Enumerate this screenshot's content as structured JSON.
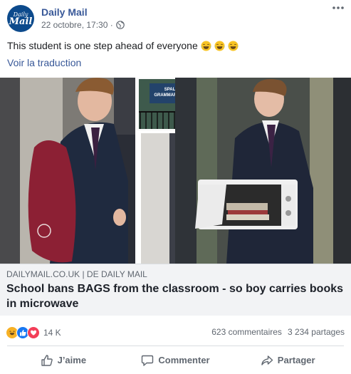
{
  "post": {
    "page_name": "Daily Mail",
    "avatar": {
      "line1": "Daily",
      "line2": "Mail"
    },
    "timestamp": "22 octobre, 17:30 ·",
    "text": "This student is one step ahead of everyone",
    "emojis": [
      "laughing-tears-emoji",
      "laughing-tears-emoji",
      "laughing-tears-emoji"
    ],
    "translate_link": "Voir la traduction"
  },
  "photo": {
    "sign_line1": "SPALDING",
    "sign_line2": "GRAMMAR SCHOOL"
  },
  "link_preview": {
    "domain": "DAILYMAIL.CO.UK",
    "separator": " | DE ",
    "source": "DAILY MAIL",
    "title": "School bans BAGS from the classroom - so boy carries books in microwave"
  },
  "stats": {
    "reaction_count": "14 K",
    "comments": "623 commentaires",
    "shares": "3 234 partages"
  },
  "actions": {
    "like": "J’aime",
    "comment": "Commenter",
    "share": "Partager"
  },
  "colors": {
    "link": "#385898",
    "haha": "#f7b125",
    "like": "#1877f2",
    "love": "#f33e58"
  }
}
